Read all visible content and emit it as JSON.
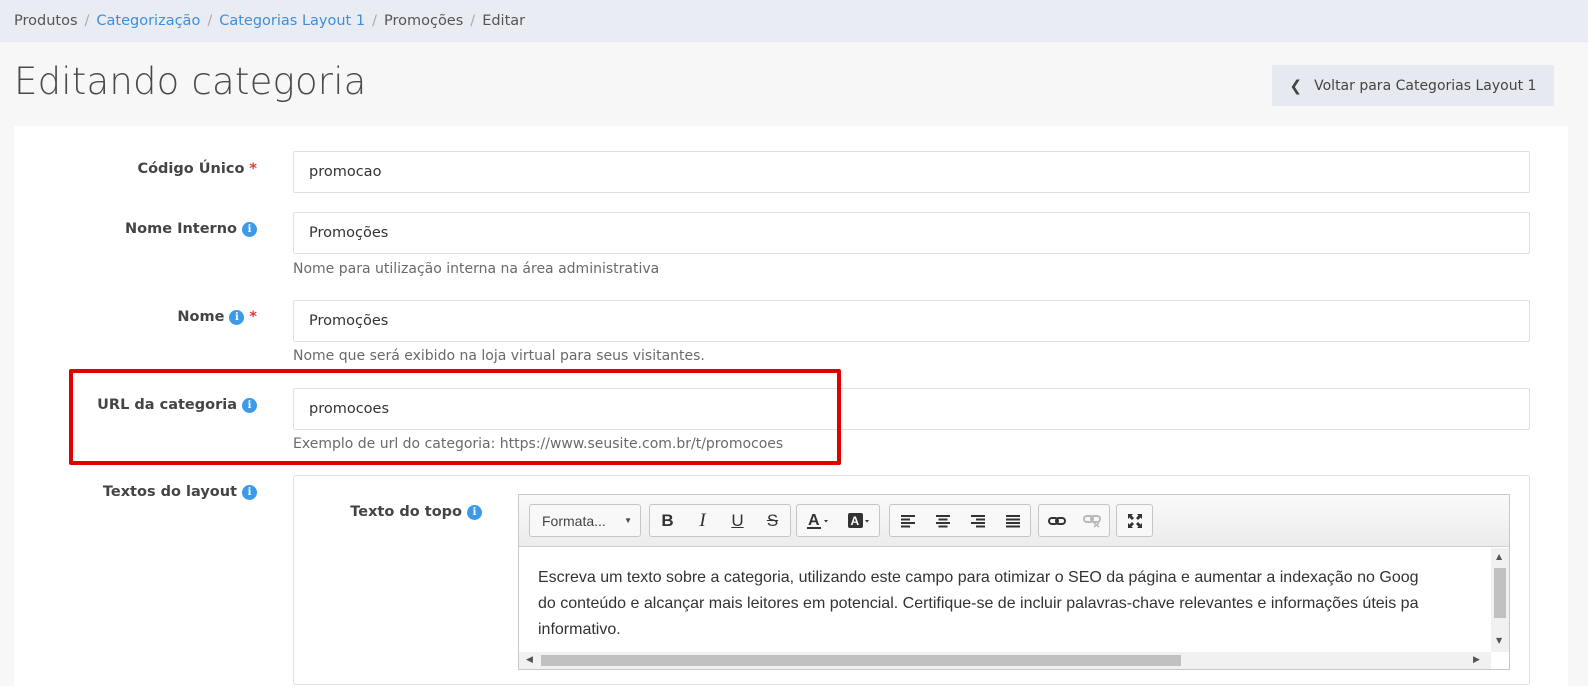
{
  "breadcrumb": [
    {
      "label": "Produtos",
      "link": false
    },
    {
      "label": "Categorização",
      "link": true
    },
    {
      "label": "Categorias Layout 1",
      "link": true
    },
    {
      "label": "Promoções",
      "link": false
    },
    {
      "label": "Editar",
      "link": false
    }
  ],
  "breadcrumb_separator": "/",
  "page": {
    "title": "Editando categoria",
    "back_button": "Voltar para Categorias Layout 1"
  },
  "form": {
    "codigo_unico": {
      "label": "Código Único",
      "required_mark": "*",
      "value": "promocao"
    },
    "nome_interno": {
      "label": "Nome Interno",
      "value": "Promoções",
      "help": "Nome para utilização interna na área administrativa"
    },
    "nome": {
      "label": "Nome",
      "required_mark": "*",
      "value": "Promoções",
      "help": "Nome que será exibido na loja virtual para seus visitantes."
    },
    "url_categoria": {
      "label": "URL da categoria",
      "value": "promocoes",
      "help": "Exemplo de url do categoria: https://www.seusite.com.br/t/promocoes"
    },
    "textos_layout": {
      "label": "Textos do layout"
    },
    "texto_topo": {
      "label": "Texto do topo"
    }
  },
  "info_icon_glyph": "i",
  "editor": {
    "format_select": "Formata...",
    "toolbar_icons": [
      "bold-icon",
      "italic-icon",
      "underline-icon",
      "strikethrough-icon",
      "text-color-icon",
      "background-color-icon",
      "align-left-icon",
      "align-center-icon",
      "align-right-icon",
      "align-justify-icon",
      "link-icon",
      "unlink-icon",
      "fullscreen-icon"
    ],
    "content_lines": [
      "Escreva um texto sobre a categoria, utilizando este campo para otimizar o SEO da página e aumentar a indexação no Goog",
      "do conteúdo e alcançar mais leitores em potencial. Certifique-se de incluir palavras-chave relevantes e informações úteis pa",
      "informativo."
    ]
  },
  "colors": {
    "link": "#3b8fde",
    "info_icon": "#3b9be8",
    "required": "#e53935",
    "highlight_border": "#e00000",
    "breadcrumb_bg": "#e9ecf3"
  }
}
